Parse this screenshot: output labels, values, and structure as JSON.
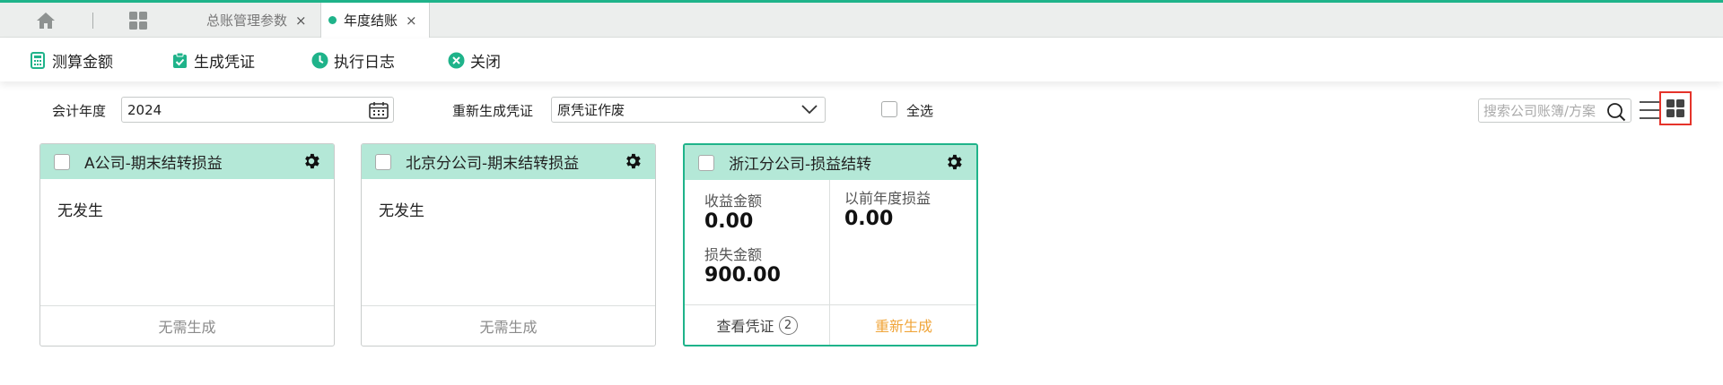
{
  "tabs": [
    {
      "label": "总账管理参数",
      "close": "×"
    },
    {
      "label": "年度结账",
      "close": "×"
    }
  ],
  "toolbar": {
    "calc": "测算金额",
    "gen_voucher": "生成凭证",
    "log": "执行日志",
    "close": "关闭"
  },
  "filters": {
    "year_label": "会计年度",
    "year_value": "2024",
    "regen_label": "重新生成凭证",
    "regen_value": "原凭证作废",
    "select_all": "全选",
    "search_placeholder": "搜索公司账簿/方案"
  },
  "cards": [
    {
      "title": "A公司-期末结转损益",
      "body": "无发生",
      "footer": "无需生成"
    },
    {
      "title": "北京分公司-期末结转损益",
      "body": "无发生",
      "footer": "无需生成"
    },
    {
      "title": "浙江分公司-损益结转",
      "income_label": "收益金额",
      "income_value": "0.00",
      "loss_label": "损失金额",
      "loss_value": "900.00",
      "prior_label": "以前年度损益",
      "prior_value": "0.00",
      "view_voucher": "查看凭证",
      "voucher_count": "2",
      "regenerate": "重新生成"
    }
  ],
  "colors": {
    "accent": "#1fb38a",
    "card_header": "#b4e8d7",
    "regen_link": "#f0a53a",
    "highlight": "#e5332a"
  }
}
